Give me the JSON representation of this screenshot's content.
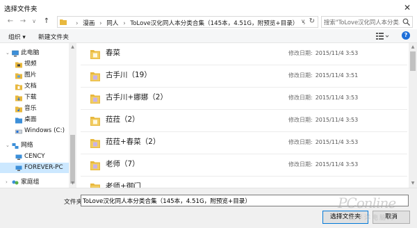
{
  "window": {
    "title": "选择文件夹",
    "close_glyph": "✕"
  },
  "nav_buttons": {
    "back": "←",
    "forward": "→",
    "dropdown": "∨",
    "up": "↑"
  },
  "address": {
    "crumbs": [
      "漫画",
      "同人",
      "ToLove汉化同人本分类合集（145本，4.51G，附预览+目录）"
    ],
    "separator": "›",
    "dropdown_glyph": "∨",
    "refresh_glyph": "↻"
  },
  "search": {
    "placeholder": "搜索\"ToLove汉化同人本分类..."
  },
  "toolbar": {
    "organize": "组织 ▾",
    "new_folder": "新建文件夹",
    "help_glyph": "?"
  },
  "sidebar": {
    "items": [
      {
        "label": "此电脑",
        "icon": "computer-icon"
      },
      {
        "label": "视频",
        "icon": "video-folder-icon"
      },
      {
        "label": "图片",
        "icon": "pictures-folder-icon"
      },
      {
        "label": "文档",
        "icon": "documents-folder-icon"
      },
      {
        "label": "下载",
        "icon": "downloads-folder-icon"
      },
      {
        "label": "音乐",
        "icon": "music-folder-icon"
      },
      {
        "label": "桌面",
        "icon": "desktop-folder-icon"
      },
      {
        "label": "Windows (C:)",
        "icon": "drive-icon"
      },
      {
        "label": "网络",
        "icon": "network-icon"
      },
      {
        "label": "CENCY",
        "icon": "network-computer-icon"
      },
      {
        "label": "FOREVER-PC",
        "icon": "network-computer-icon"
      },
      {
        "label": "家庭组",
        "icon": "homegroup-icon"
      }
    ],
    "selected": "FOREVER-PC"
  },
  "files": {
    "date_label": "修改日期:",
    "items": [
      {
        "name": "春菜",
        "date": "2015/11/4 3:53"
      },
      {
        "name": "古手川（19）",
        "date": "2015/11/4 3:51"
      },
      {
        "name": "古手川+娜娜（2）",
        "date": "2015/11/4 3:53"
      },
      {
        "name": "菈菈（2）",
        "date": "2015/11/4 3:53"
      },
      {
        "name": "菈菈+春菜（2）",
        "date": "2015/11/4 3:53"
      },
      {
        "name": "老师（7）",
        "date": "2015/11/4 3:53"
      },
      {
        "name": "老师+御门",
        "date": ""
      }
    ]
  },
  "footer": {
    "folder_label": "文件夹:",
    "folder_value": "ToLove汉化同人本分类合集（145本，4.51G，附预览+目录）",
    "select_button": "选择文件夹",
    "cancel_button": "取消"
  },
  "watermark": {
    "brand": "PConline",
    "sub": "太平洋电脑网"
  },
  "colors": {
    "accent": "#0078d7",
    "selection": "#cce8ff",
    "folder": "#e8b83e",
    "help": "#1e6fd9"
  }
}
